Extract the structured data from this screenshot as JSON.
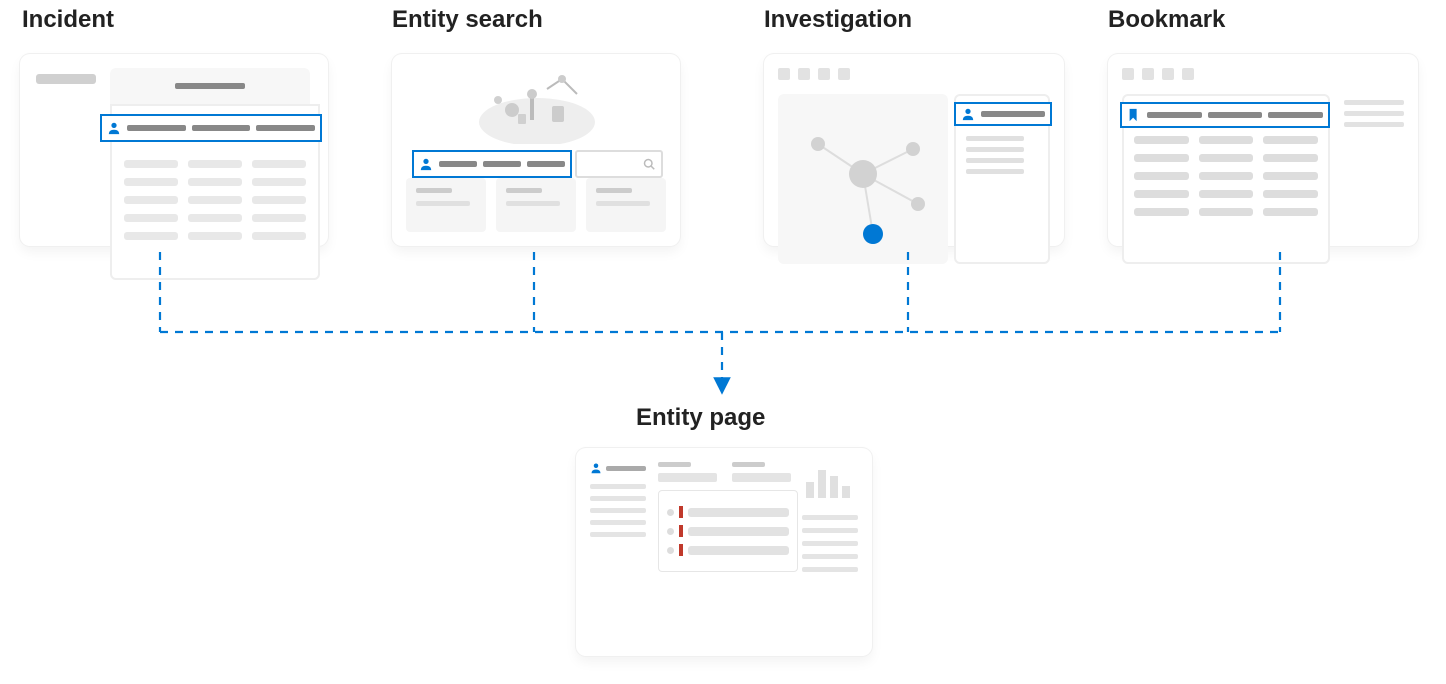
{
  "diagram": {
    "sources": [
      {
        "label": "Incident"
      },
      {
        "label": "Entity search"
      },
      {
        "label": "Investigation"
      },
      {
        "label": "Bookmark"
      }
    ],
    "target": {
      "label": "Entity page"
    }
  },
  "colors": {
    "accent": "#0078d4",
    "grey_light": "#e8e8e8",
    "grey_mid": "#d0d0d0",
    "grey_dark": "#888",
    "alert": "#c0392b"
  }
}
